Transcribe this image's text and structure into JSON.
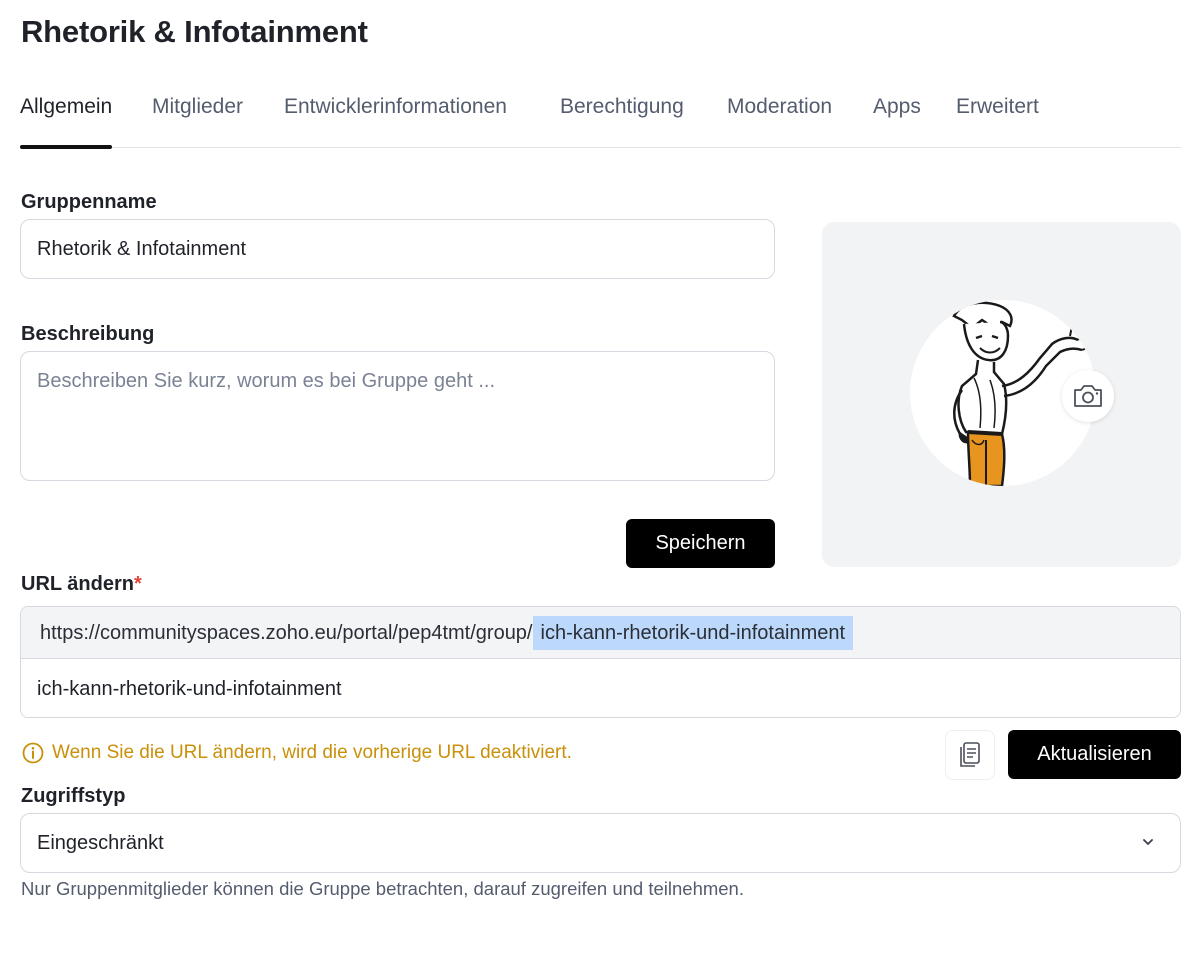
{
  "page": {
    "title": "Rhetorik & Infotainment"
  },
  "tabs": [
    {
      "label": "Allgemein",
      "active": true
    },
    {
      "label": "Mitglieder"
    },
    {
      "label": "Entwicklerinformationen"
    },
    {
      "label": "Berechtigung"
    },
    {
      "label": "Moderation"
    },
    {
      "label": "Apps"
    },
    {
      "label": "Erweitert"
    }
  ],
  "form": {
    "group_name_label": "Gruppenname",
    "group_name_value": "Rhetorik & Infotainment",
    "description_label": "Beschreibung",
    "description_placeholder": "Beschreiben Sie kurz, worum es bei Gruppe geht ...",
    "save_label": "Speichern"
  },
  "avatar": {
    "image_icon": "cartoon-man-illustration",
    "camera_icon": "camera-icon"
  },
  "url": {
    "label": "URL ändern",
    "required_mark": "*",
    "prefix": "https://communityspaces.zoho.eu/portal/pep4tmt/group/",
    "slug_highlight": "ich-kann-rhetorik-und-infotainment",
    "slug_value": "ich-kann-rhetorik-und-infotainment",
    "warning": "Wenn Sie die URL ändern, wird die vorherige URL deaktiviert.",
    "update_label": "Aktualisieren",
    "copy_icon": "copy-icon"
  },
  "access": {
    "label": "Zugriffstyp",
    "selected": "Eingeschränkt",
    "helper": "Nur Gruppenmitglieder können die Gruppe betrachten, darauf zugreifen und teilnehmen."
  },
  "colors": {
    "warning": "#c9900a",
    "highlight": "#bcd8fa",
    "required": "#e0453c",
    "button": "#000000",
    "pants": "#e8951f"
  }
}
